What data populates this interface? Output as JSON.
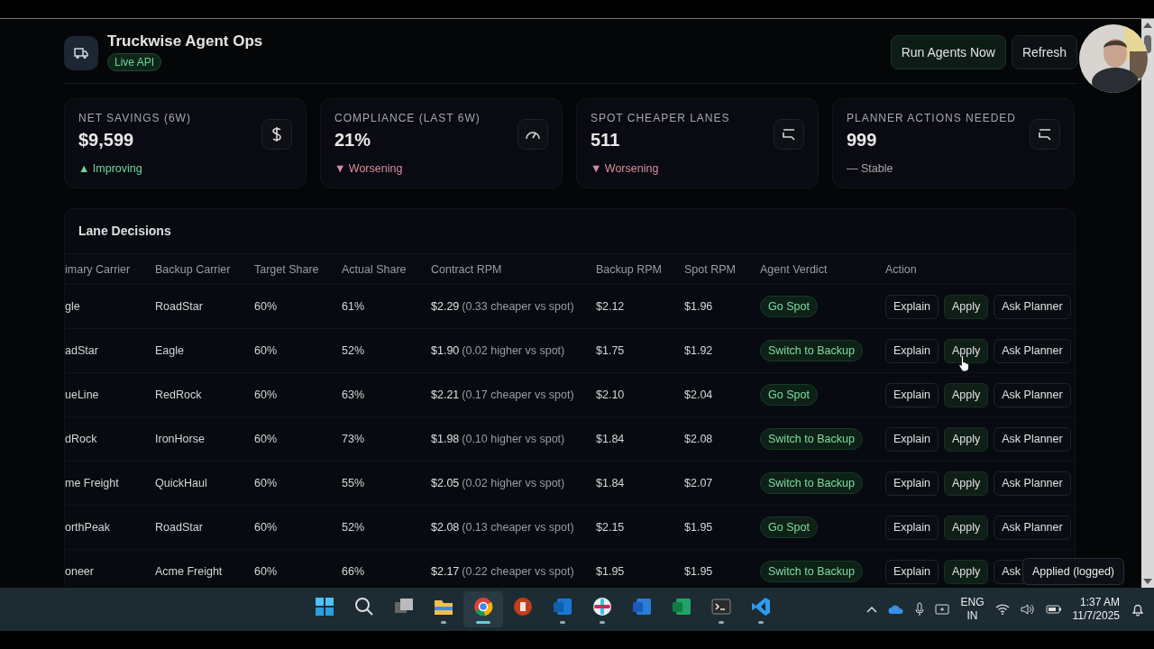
{
  "header": {
    "title": "Truckwise Agent Ops",
    "badge": "Live API",
    "buttons": [
      {
        "label": "Run Agents Now",
        "kind": "primary"
      },
      {
        "label": "Refresh",
        "kind": "default"
      }
    ]
  },
  "kpis": [
    {
      "label": "NET SAVINGS (6W)",
      "value": "$9,599",
      "trend": "▲ Improving",
      "kind": "up"
    },
    {
      "label": "COMPLIANCE (LAST 6W)",
      "value": "21%",
      "trend": "▼ Worsening",
      "kind": "down"
    },
    {
      "label": "SPOT CHEAPER LANES",
      "value": "511",
      "trend": "▼ Worsening",
      "kind": "down"
    },
    {
      "label": "PLANNER ACTIONS NEEDED",
      "value": "999",
      "trend": "— Stable",
      "kind": "flat"
    }
  ],
  "table": {
    "title": "Lane Decisions",
    "columns": [
      "imary Carrier",
      "Backup Carrier",
      "Target Share",
      "Actual Share",
      "Contract RPM",
      "Backup RPM",
      "Spot RPM",
      "Agent Verdict",
      "Action"
    ],
    "rows": [
      {
        "primary": "gle",
        "backup": "RoadStar",
        "target": "60%",
        "actual": "61%",
        "contract_rpm": "$2.29",
        "contract_note": "(0.33 cheaper vs spot)",
        "backup_rpm": "$2.12",
        "spot_rpm": "$1.96",
        "verdict": "Go Spot",
        "actions": [
          "Explain",
          "Apply",
          "Ask Planner"
        ]
      },
      {
        "primary": "adStar",
        "backup": "Eagle",
        "target": "60%",
        "actual": "52%",
        "contract_rpm": "$1.90",
        "contract_note": "(0.02 higher vs spot)",
        "backup_rpm": "$1.75",
        "spot_rpm": "$1.92",
        "verdict": "Switch to Backup",
        "actions": [
          "Explain",
          "Apply",
          "Ask Planner"
        ]
      },
      {
        "primary": "ueLine",
        "backup": "RedRock",
        "target": "60%",
        "actual": "63%",
        "contract_rpm": "$2.21",
        "contract_note": "(0.17 cheaper vs spot)",
        "backup_rpm": "$2.10",
        "spot_rpm": "$2.04",
        "verdict": "Go Spot",
        "actions": [
          "Explain",
          "Apply",
          "Ask Planner"
        ]
      },
      {
        "primary": "dRock",
        "backup": "IronHorse",
        "target": "60%",
        "actual": "73%",
        "contract_rpm": "$1.98",
        "contract_note": "(0.10 higher vs spot)",
        "backup_rpm": "$1.84",
        "spot_rpm": "$2.08",
        "verdict": "Switch to Backup",
        "actions": [
          "Explain",
          "Apply",
          "Ask Planner"
        ]
      },
      {
        "primary": "me Freight",
        "backup": "QuickHaul",
        "target": "60%",
        "actual": "55%",
        "contract_rpm": "$2.05",
        "contract_note": "(0.02 higher vs spot)",
        "backup_rpm": "$1.84",
        "spot_rpm": "$2.07",
        "verdict": "Switch to Backup",
        "actions": [
          "Explain",
          "Apply",
          "Ask Planner"
        ]
      },
      {
        "primary": "orthPeak",
        "backup": "RoadStar",
        "target": "60%",
        "actual": "52%",
        "contract_rpm": "$2.08",
        "contract_note": "(0.13 cheaper vs spot)",
        "backup_rpm": "$2.15",
        "spot_rpm": "$1.95",
        "verdict": "Go Spot",
        "actions": [
          "Explain",
          "Apply",
          "Ask Planner"
        ]
      },
      {
        "primary": "oneer",
        "backup": "Acme Freight",
        "target": "60%",
        "actual": "66%",
        "contract_rpm": "$2.17",
        "contract_note": "(0.22 cheaper vs spot)",
        "backup_rpm": "$1.95",
        "spot_rpm": "$1.95",
        "verdict": "Switch to Backup",
        "actions": [
          "Explain",
          "Apply",
          "Ask"
        ]
      }
    ]
  },
  "toast": "Applied (logged)",
  "taskbar": {
    "apps": [
      {
        "kind": "start",
        "running": false,
        "selected": false
      },
      {
        "kind": "search",
        "running": false,
        "selected": false
      },
      {
        "kind": "taskview",
        "running": false,
        "selected": false
      },
      {
        "kind": "folder",
        "running": true,
        "selected": false
      },
      {
        "kind": "browser",
        "running": true,
        "selected": true
      },
      {
        "kind": "slides",
        "running": false,
        "selected": false
      },
      {
        "kind": "mail",
        "running": true,
        "selected": false
      },
      {
        "kind": "chat",
        "running": true,
        "selected": false
      },
      {
        "kind": "doc",
        "running": false,
        "selected": false
      },
      {
        "kind": "sheet",
        "running": false,
        "selected": false
      },
      {
        "kind": "terminal",
        "running": true,
        "selected": false
      },
      {
        "kind": "code",
        "running": true,
        "selected": false
      }
    ],
    "language": [
      "ENG",
      "IN"
    ],
    "time": "1:37 AM",
    "date": "11/7/2025"
  }
}
